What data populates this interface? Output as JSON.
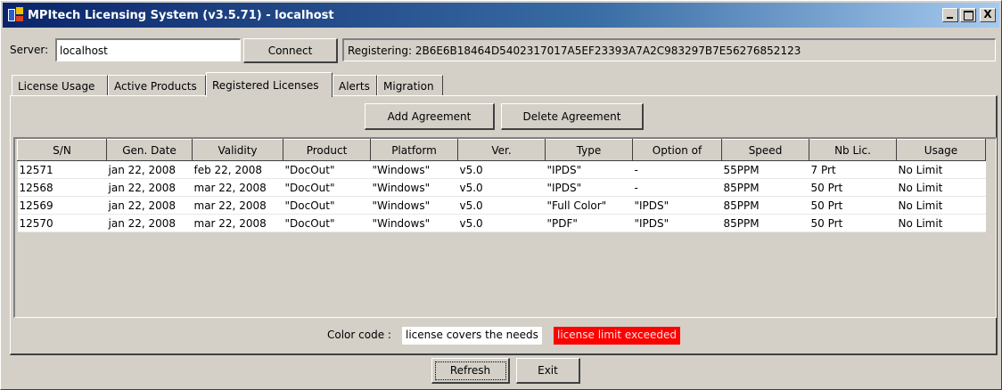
{
  "window": {
    "title": "MPItech Licensing System (v3.5.71) - localhost",
    "close_glyph": "X"
  },
  "server": {
    "label": "Server:",
    "value": "localhost",
    "connect_label": "Connect",
    "status": "Registering: 2B6E6B18464D5402317017A5EF23393A7A2C983297B7E56276852123"
  },
  "tabs": [
    {
      "label": "License Usage"
    },
    {
      "label": "Active Products"
    },
    {
      "label": "Registered Licenses",
      "active": true
    },
    {
      "label": "Alerts"
    },
    {
      "label": "Migration"
    }
  ],
  "actions": {
    "add_label": "Add Agreement",
    "delete_label": "Delete Agreement"
  },
  "table": {
    "columns": [
      "S/N",
      "Gen. Date",
      "Validity",
      "Product",
      "Platform",
      "Ver.",
      "Type",
      "Option of",
      "Speed",
      "Nb Lic.",
      "Usage"
    ],
    "rows": [
      [
        "12571",
        "jan 22, 2008",
        "feb 22, 2008",
        "\"DocOut\"",
        "\"Windows\"",
        "v5.0",
        "\"IPDS\"",
        "-",
        "55PPM",
        "7 Prt",
        "No Limit"
      ],
      [
        "12568",
        "jan 22, 2008",
        "mar 22, 2008",
        "\"DocOut\"",
        "\"Windows\"",
        "v5.0",
        "\"IPDS\"",
        "-",
        "85PPM",
        "50 Prt",
        "No Limit"
      ],
      [
        "12569",
        "jan 22, 2008",
        "mar 22, 2008",
        "\"DocOut\"",
        "\"Windows\"",
        "v5.0",
        "\"Full Color\"",
        "\"IPDS\"",
        "85PPM",
        "50 Prt",
        "No Limit"
      ],
      [
        "12570",
        "jan 22, 2008",
        "mar 22, 2008",
        "\"DocOut\"",
        "\"Windows\"",
        "v5.0",
        "\"PDF\"",
        "\"IPDS\"",
        "85PPM",
        "50 Prt",
        "No Limit"
      ]
    ]
  },
  "color_code": {
    "label": "Color code :",
    "ok_text": "license covers the needs",
    "exceeded_text": "license limit exceeded",
    "exceeded_color": "#ff0000"
  },
  "footer": {
    "refresh_label": "Refresh",
    "exit_label": "Exit"
  }
}
